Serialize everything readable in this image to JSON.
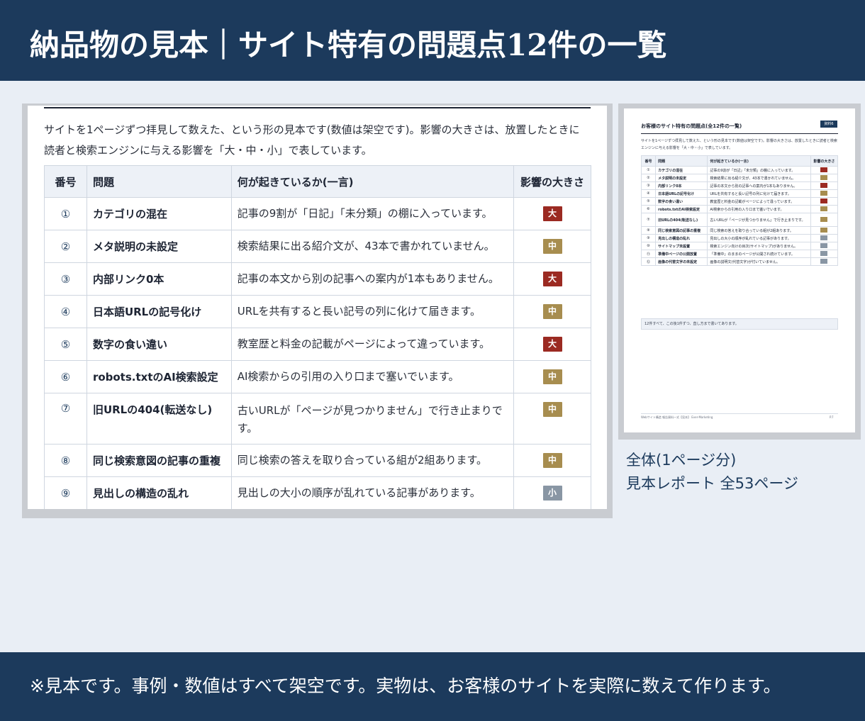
{
  "header": {
    "title": "納品物の見本｜サイト特有の問題点12件の一覧"
  },
  "zoom": {
    "intro": "サイトを1ページずつ拝見して数えた、という形の見本です(数値は架空です)。影響の大きさは、放置したときに読者と検索エンジンに与える影響を「大・中・小」で表しています。",
    "columns": [
      "番号",
      "問題",
      "何が起きているか(一言)",
      "影響の大きさ"
    ],
    "rows": [
      {
        "no": "①",
        "problem": "カテゴリの混在",
        "desc": "記事の9割が「日記」「未分類」の棚に入っています。",
        "impact": "大"
      },
      {
        "no": "②",
        "problem": "メタ説明の未設定",
        "desc": "検索結果に出る紹介文が、43本で書かれていません。",
        "impact": "中"
      },
      {
        "no": "③",
        "problem": "内部リンク0本",
        "desc": "記事の本文から別の記事への案内が1本もありません。",
        "impact": "大"
      },
      {
        "no": "④",
        "problem": "日本語URLの記号化け",
        "desc": "URLを共有すると長い記号の列に化けて届きます。",
        "impact": "中"
      },
      {
        "no": "⑤",
        "problem": "数字の食い違い",
        "desc": "教室歴と料金の記載がページによって違っています。",
        "impact": "大"
      },
      {
        "no": "⑥",
        "problem": "robots.txtのAI検索設定",
        "desc": "AI検索からの引用の入り口まで塞いでいます。",
        "impact": "中"
      },
      {
        "no": "⑦",
        "problem": "旧URLの404(転送なし)",
        "desc": "古いURLが「ページが見つかりません」で行き止まりです。",
        "impact": "中"
      },
      {
        "no": "⑧",
        "problem": "同じ検索意図の記事の重複",
        "desc": "同じ検索の答えを取り合っている組が2組あります。",
        "impact": "中"
      },
      {
        "no": "⑨",
        "problem": "見出しの構造の乱れ",
        "desc": "見出しの大小の順序が乱れている記事があります。",
        "impact": "小"
      }
    ]
  },
  "thumb": {
    "title": "お客様のサイト特有の問題点(全12件の一覧)",
    "tag": "資料6",
    "intro": "サイトを1ページずつ拝見して数えた、という形の見本です(数値は架空です)。影響の大きさは、放置したときに読者と検索エンジンに与える影響を「大・中・小」で表しています。",
    "columns": [
      "番号",
      "問題",
      "何が起きているか(一言)",
      "影響の大きさ"
    ],
    "rows": [
      {
        "no": "①",
        "problem": "カテゴリの混在",
        "desc": "記事の9割が「日記」「未分類」の棚に入っています。",
        "impact": "大"
      },
      {
        "no": "②",
        "problem": "メタ説明の未設定",
        "desc": "検索結果に出る紹介文が、43本で書かれていません。",
        "impact": "中"
      },
      {
        "no": "③",
        "problem": "内部リンク0本",
        "desc": "記事の本文から別の記事への案内が1本もありません。",
        "impact": "大"
      },
      {
        "no": "④",
        "problem": "日本語URLの記号化け",
        "desc": "URLを共有すると長い記号の列に化けて届きます。",
        "impact": "中"
      },
      {
        "no": "⑤",
        "problem": "数字の食い違い",
        "desc": "教室歴と料金の記載がページによって違っています。",
        "impact": "大"
      },
      {
        "no": "⑥",
        "problem": "robots.txtのAI検索設定",
        "desc": "AI検索からの引用の入り口まで塞いでいます。",
        "impact": "中"
      },
      {
        "no": "⑦",
        "problem": "旧URLの404(転送なし)",
        "desc": "古いURLが「ページが見つかりません」で行き止まりです。",
        "impact": "中"
      },
      {
        "no": "⑧",
        "problem": "同じ検索意図の記事の重複",
        "desc": "同じ検索の答えを取り合っている組が2組あります。",
        "impact": "中"
      },
      {
        "no": "⑨",
        "problem": "見出しの構造の乱れ",
        "desc": "見出しの大小の順序が乱れている記事があります。",
        "impact": "小"
      },
      {
        "no": "⑩",
        "problem": "サイトマップ未設置",
        "desc": "検索エンジン向けの目次(サイトマップ)がありません。",
        "impact": "小"
      },
      {
        "no": "⑪",
        "problem": "準備中ページの公開放置",
        "desc": "「準備中」のままのページが公開され続けています。",
        "impact": "小"
      },
      {
        "no": "⑫",
        "problem": "画像の代替文字の未設定",
        "desc": "画像の説明文(代替文字)が付いていません。",
        "impact": "小"
      }
    ],
    "note": "12件すべて、この後1件ずつ、直し方まで書いてあります。",
    "footer": "Webサイト構造 報告資料一式【見本】 Ever-Marketing",
    "page": "P.7"
  },
  "caption": {
    "line1": "全体(1ページ分)",
    "line2": "見本レポート 全53ページ"
  },
  "footer": {
    "text": "※見本です。事例・数値はすべて架空です。実物は、お客様のサイトを実際に数えて作ります。"
  },
  "colors": {
    "navy": "#1c3a5c",
    "impact_big": "#9b2a22",
    "impact_mid": "#a78d4f",
    "impact_small": "#8996a4"
  }
}
